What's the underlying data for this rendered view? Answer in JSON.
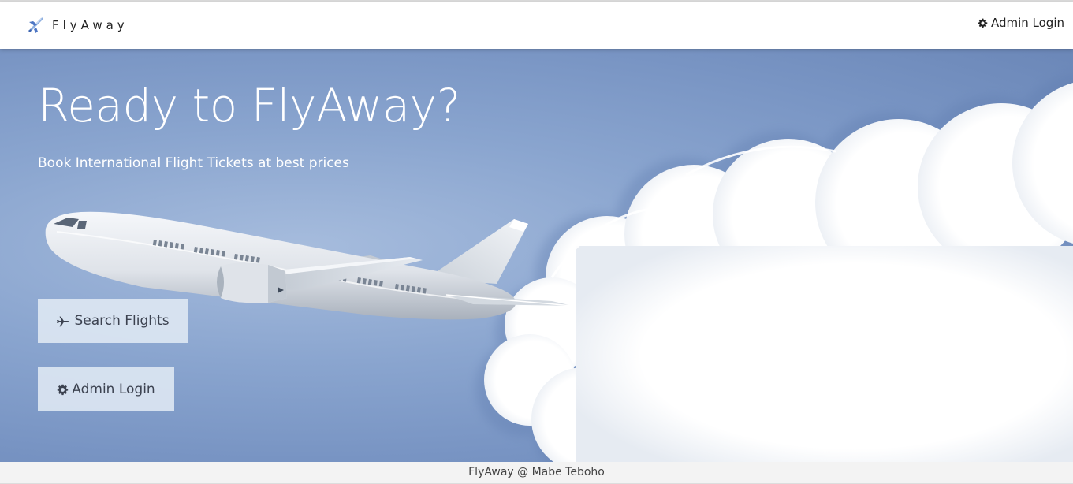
{
  "navbar": {
    "brand": "FlyAway",
    "admin_login": "Admin Login"
  },
  "hero": {
    "title": "Ready to FlyAway?",
    "subtitle": "Book International Flight Tickets at best prices",
    "search_button": "Search Flights",
    "admin_button": "Admin Login"
  },
  "footer": {
    "text": "FlyAway @ Mabe Teboho"
  },
  "icons": {
    "brand": "airplane-logo-icon",
    "admin": "gear-icon",
    "search": "plane-icon"
  },
  "colors": {
    "hero_background": "#7f9bc9",
    "button_background": "#dfe8f3",
    "footer_background": "#f3f3f3"
  }
}
